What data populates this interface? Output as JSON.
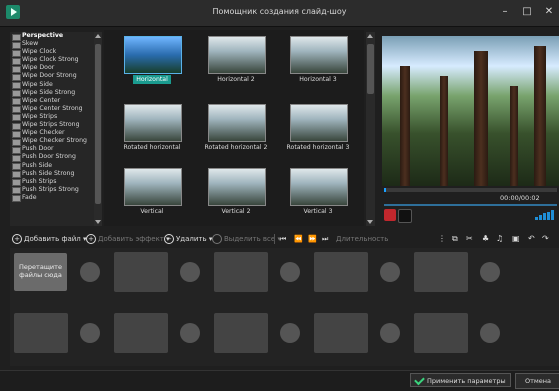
{
  "window": {
    "title": "Помощник создания слайд-шоу",
    "minimize": "–",
    "maximize": "□",
    "close": "✕"
  },
  "effects": [
    "Perspective",
    "Skew",
    "Wipe Clock",
    "Wipe Clock Strong",
    "Wipe Door",
    "Wipe Door Strong",
    "Wipe Side",
    "Wipe Side Strong",
    "Wipe Center",
    "Wipe Center Strong",
    "Wipe Strips",
    "Wipe Strips Strong",
    "Wipe Checker",
    "Wipe Checker Strong",
    "Push Door",
    "Push Door Strong",
    "Push Side",
    "Push Side Strong",
    "Push Strips",
    "Push Strips Strong",
    "Fade"
  ],
  "thumbnails": [
    "Horizontal",
    "Horizontal 2",
    "Horizontal 3",
    "Rotated horizontal",
    "Rotated horizontal 2",
    "Rotated horizontal 3",
    "Vertical",
    "Vertical 2",
    "Vertical 3"
  ],
  "preview": {
    "time": "00:00/00:02"
  },
  "toolbar": {
    "add_file": "Добавить файл",
    "add_effect": "Добавить эффект",
    "delete": "Удалить",
    "select_all": "Выделить все",
    "duration": "Длительность"
  },
  "timeline": {
    "drop_text": "Перетащите файлы сюда"
  },
  "footer": {
    "apply": "Применить параметры",
    "cancel": "Отмена"
  },
  "colors": {
    "accent": "#1a9b8f",
    "selection_border": "#5ab1e8"
  }
}
